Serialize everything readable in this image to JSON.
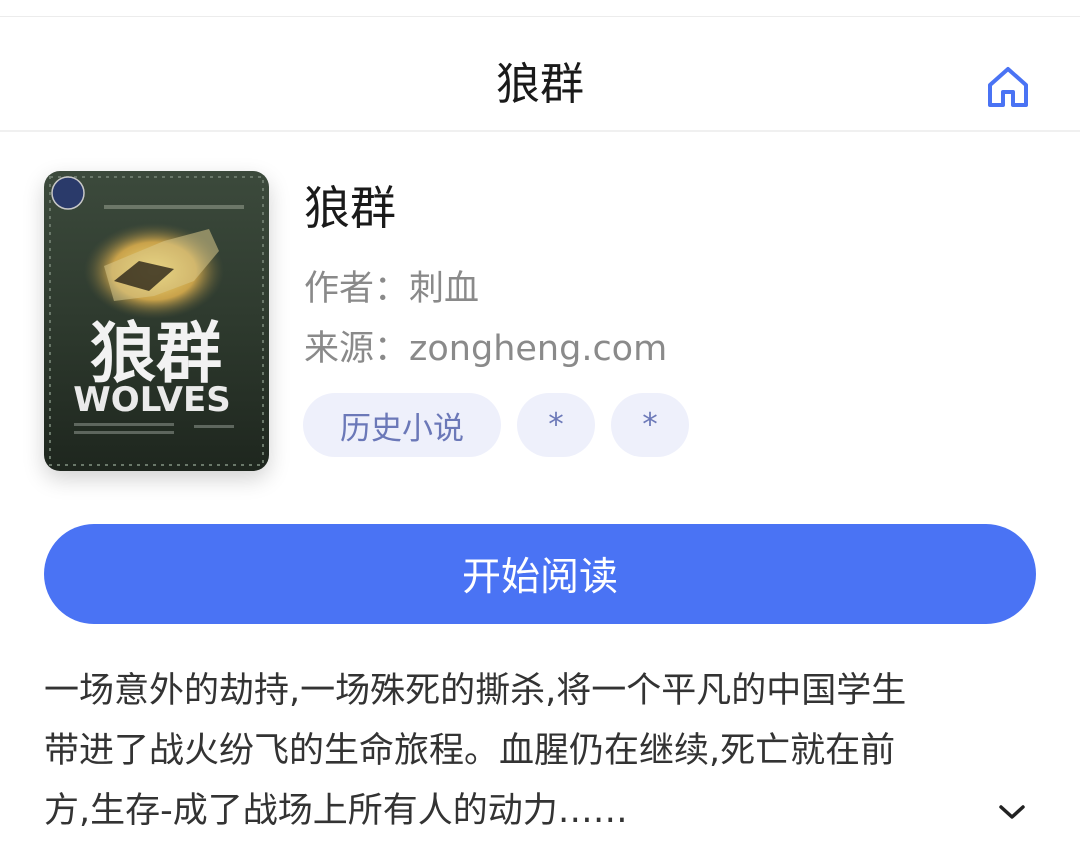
{
  "nav": {
    "title": "狼群",
    "home_icon": "home-icon",
    "accent": "#4a73f4"
  },
  "book": {
    "cover_icon": "book-cover-image",
    "cover_title": "狼群",
    "cover_subtitle": "WOLVES",
    "title": "狼群",
    "author_label": "作者：",
    "author": "刺血",
    "source_label": "来源：",
    "source": "zongheng.com",
    "tags": [
      {
        "label": "历史小说"
      },
      {
        "label": "*"
      },
      {
        "label": "*"
      }
    ]
  },
  "actions": {
    "read_label": "开始阅读",
    "read_color": "#4a73f4"
  },
  "description": {
    "lines": [
      "一场意外的劫持,一场殊死的撕杀,将一个平凡的中国学生",
      "带进了战火纷飞的生命旅程。血腥仍在继续,死亡就在前",
      "方,生存-成了战场上所有人的动力……"
    ],
    "expand_icon": "chevron-down-icon"
  }
}
